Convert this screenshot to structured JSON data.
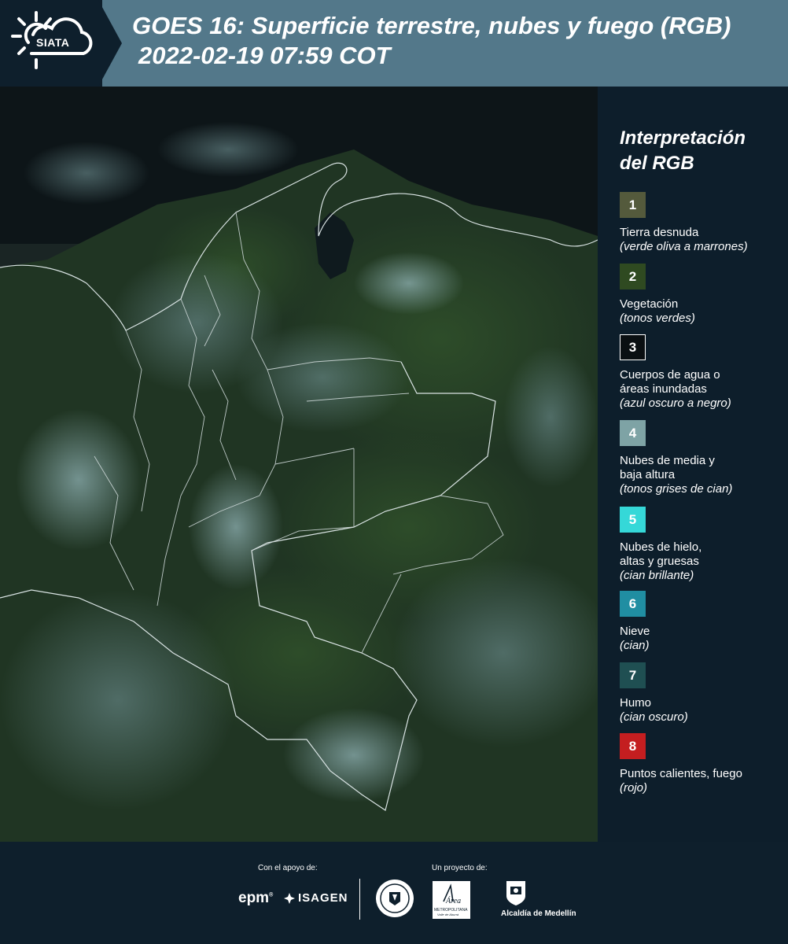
{
  "header": {
    "logo_text": "SIATA",
    "title_line1": "GOES 16: Superficie terrestre, nubes y fuego (RGB)",
    "title_line2": "2022-02-19 07:59 COT"
  },
  "legend": {
    "title_line1": "Interpretación",
    "title_line2": "del RGB",
    "items": [
      {
        "number": "1",
        "line1": "Tierra desnuda",
        "line2": "",
        "desc": "(verde oliva a marrones)",
        "color": "#545a3c"
      },
      {
        "number": "2",
        "line1": "Vegetación",
        "line2": "",
        "desc": "(tonos verdes)",
        "color": "#2f4a21"
      },
      {
        "number": "3",
        "line1": "Cuerpos de agua o",
        "line2": "áreas inundadas",
        "desc": "(azul oscuro a negro)",
        "color": "#0a0f12"
      },
      {
        "number": "4",
        "line1": "Nubes de media y",
        "line2": "baja altura",
        "desc": "(tonos grises de cian)",
        "color": "#7ea3a5"
      },
      {
        "number": "5",
        "line1": "Nubes de hielo,",
        "line2": "altas y gruesas",
        "desc": "(cian brillante)",
        "color": "#35d8d8"
      },
      {
        "number": "6",
        "line1": "Nieve",
        "line2": "",
        "desc": "(cian)",
        "color": "#208ea2"
      },
      {
        "number": "7",
        "line1": "Humo",
        "line2": "",
        "desc": "(cian oscuro)",
        "color": "#1f4f52"
      },
      {
        "number": "8",
        "line1": "Puntos calientes, fuego",
        "line2": "",
        "desc": "(rojo)",
        "color": "#c41e20"
      }
    ]
  },
  "footer": {
    "support_label": "Con el apoyo de:",
    "project_label": "Un proyecto de:",
    "epm": "epm",
    "isagen": "ISAGEN",
    "area_name": "Área",
    "area_sub": "METROPOLITANA",
    "area_sub2": "Valle de Aburrá",
    "alcaldia": "Alcaldía de Medellín"
  }
}
